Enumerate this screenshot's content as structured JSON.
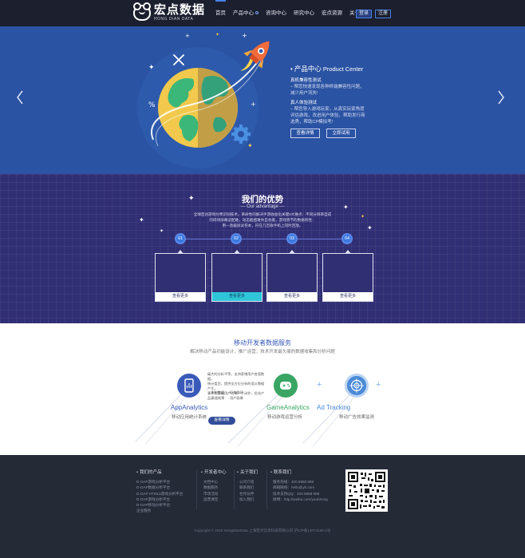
{
  "header": {
    "logo_cn": "宏点数据",
    "logo_en": "HONG DIAN DATA",
    "nav": [
      "首页",
      "产品中心",
      "咨询中心",
      "研究中心",
      "宏点资源",
      "关于我们"
    ],
    "login": "登录",
    "register": "注册"
  },
  "hero": {
    "title_cn": "产品中心",
    "title_en": "Product Center",
    "features": [
      {
        "heading": "真机兼容性测试",
        "lines": [
          "– 帮您快速发现各种终端兼容性问题，",
          "减少用户流失!"
        ]
      },
      {
        "heading": "真人体验测试",
        "lines": [
          "– 帮您导入游戏玩家，从真实玩家角度",
          "评估游戏，改进用户体验，帮助发行商",
          "选秀，帮助CP模拟考!"
        ]
      }
    ],
    "btn_detail": "查看详情",
    "btn_trial": "立即试用"
  },
  "advantage": {
    "title": "我们的优势",
    "subtitle": "— Our advantage —",
    "desc_lines": [
      "全球首创游戏付费识别技术，革命性的解决手游收益化关键3大难点：不同分辨率自成",
      "的碎块屏幕适配难，动态截图难失自会着，游戏情节的数据机性：",
      "用一劲截屏试卷本，符在几百款手机上同时回放。"
    ],
    "steps": [
      "01",
      "02",
      "03",
      "04"
    ],
    "more": "查看更多"
  },
  "services": {
    "title": "移动开发者数据服务",
    "subtitle": "解决移动产品功能设计，推广运营，技术开发最头痛的数据收集和分析问题",
    "items": [
      {
        "name": "AppAnalytics",
        "cn": "移动应用统计系统",
        "color": "#3a5ab9",
        "icon": "mobile-chart-icon"
      },
      {
        "name": "GameAnalytics",
        "cn": "移动游戏运营分析",
        "color": "#3aa564",
        "icon": "gamepad-icon"
      },
      {
        "name": "Ad Tracking",
        "cn": "移动广告效果监测",
        "color": "#4a8ad8",
        "icon": "target-icon"
      }
    ],
    "popup_lines": [
      "痛大的分析平等，支持索增用户各案数据，",
      "统计类目，提供全方位分析的语义数据产生，",
      "事件和基础用户的每一个动作，优化产品。"
    ],
    "popup_bullets": [
      "· 实时数据　· 行为路径",
      "· 渠道效果　· 用户画像"
    ],
    "popup_more": "查看详情"
  },
  "footer": {
    "columns": [
      {
        "title": "我们的产品",
        "items": [
          "D-OAP游戏分析平台",
          "D-OAP数据分析平台",
          "D-OAP HTML5游戏分析平台",
          "D-OAP游戏分析平台",
          "D-OAP移动分析平台",
          "企业服务"
        ]
      },
      {
        "title": "开发者中心",
        "items": [
          "文档中心",
          "数据服务",
          "市场活动",
          "运营课堂"
        ]
      },
      {
        "title": "关于我们",
        "items": [
          "公司介绍",
          "联系我们",
          "合作伙伴",
          "加入我们"
        ]
      },
      {
        "title": "联系我们",
        "items": [
          "服务热线：400 8888 888",
          "邮箱联络：hello@yh.com",
          "技术支持QQ：400 8888 888",
          "微博：http://weibo.com/yuanhong"
        ]
      }
    ],
    "copyright": "Copyright © 2015 HongDianData 上海宏点信息科技有限公司 沪ICP备13074195-1号"
  }
}
